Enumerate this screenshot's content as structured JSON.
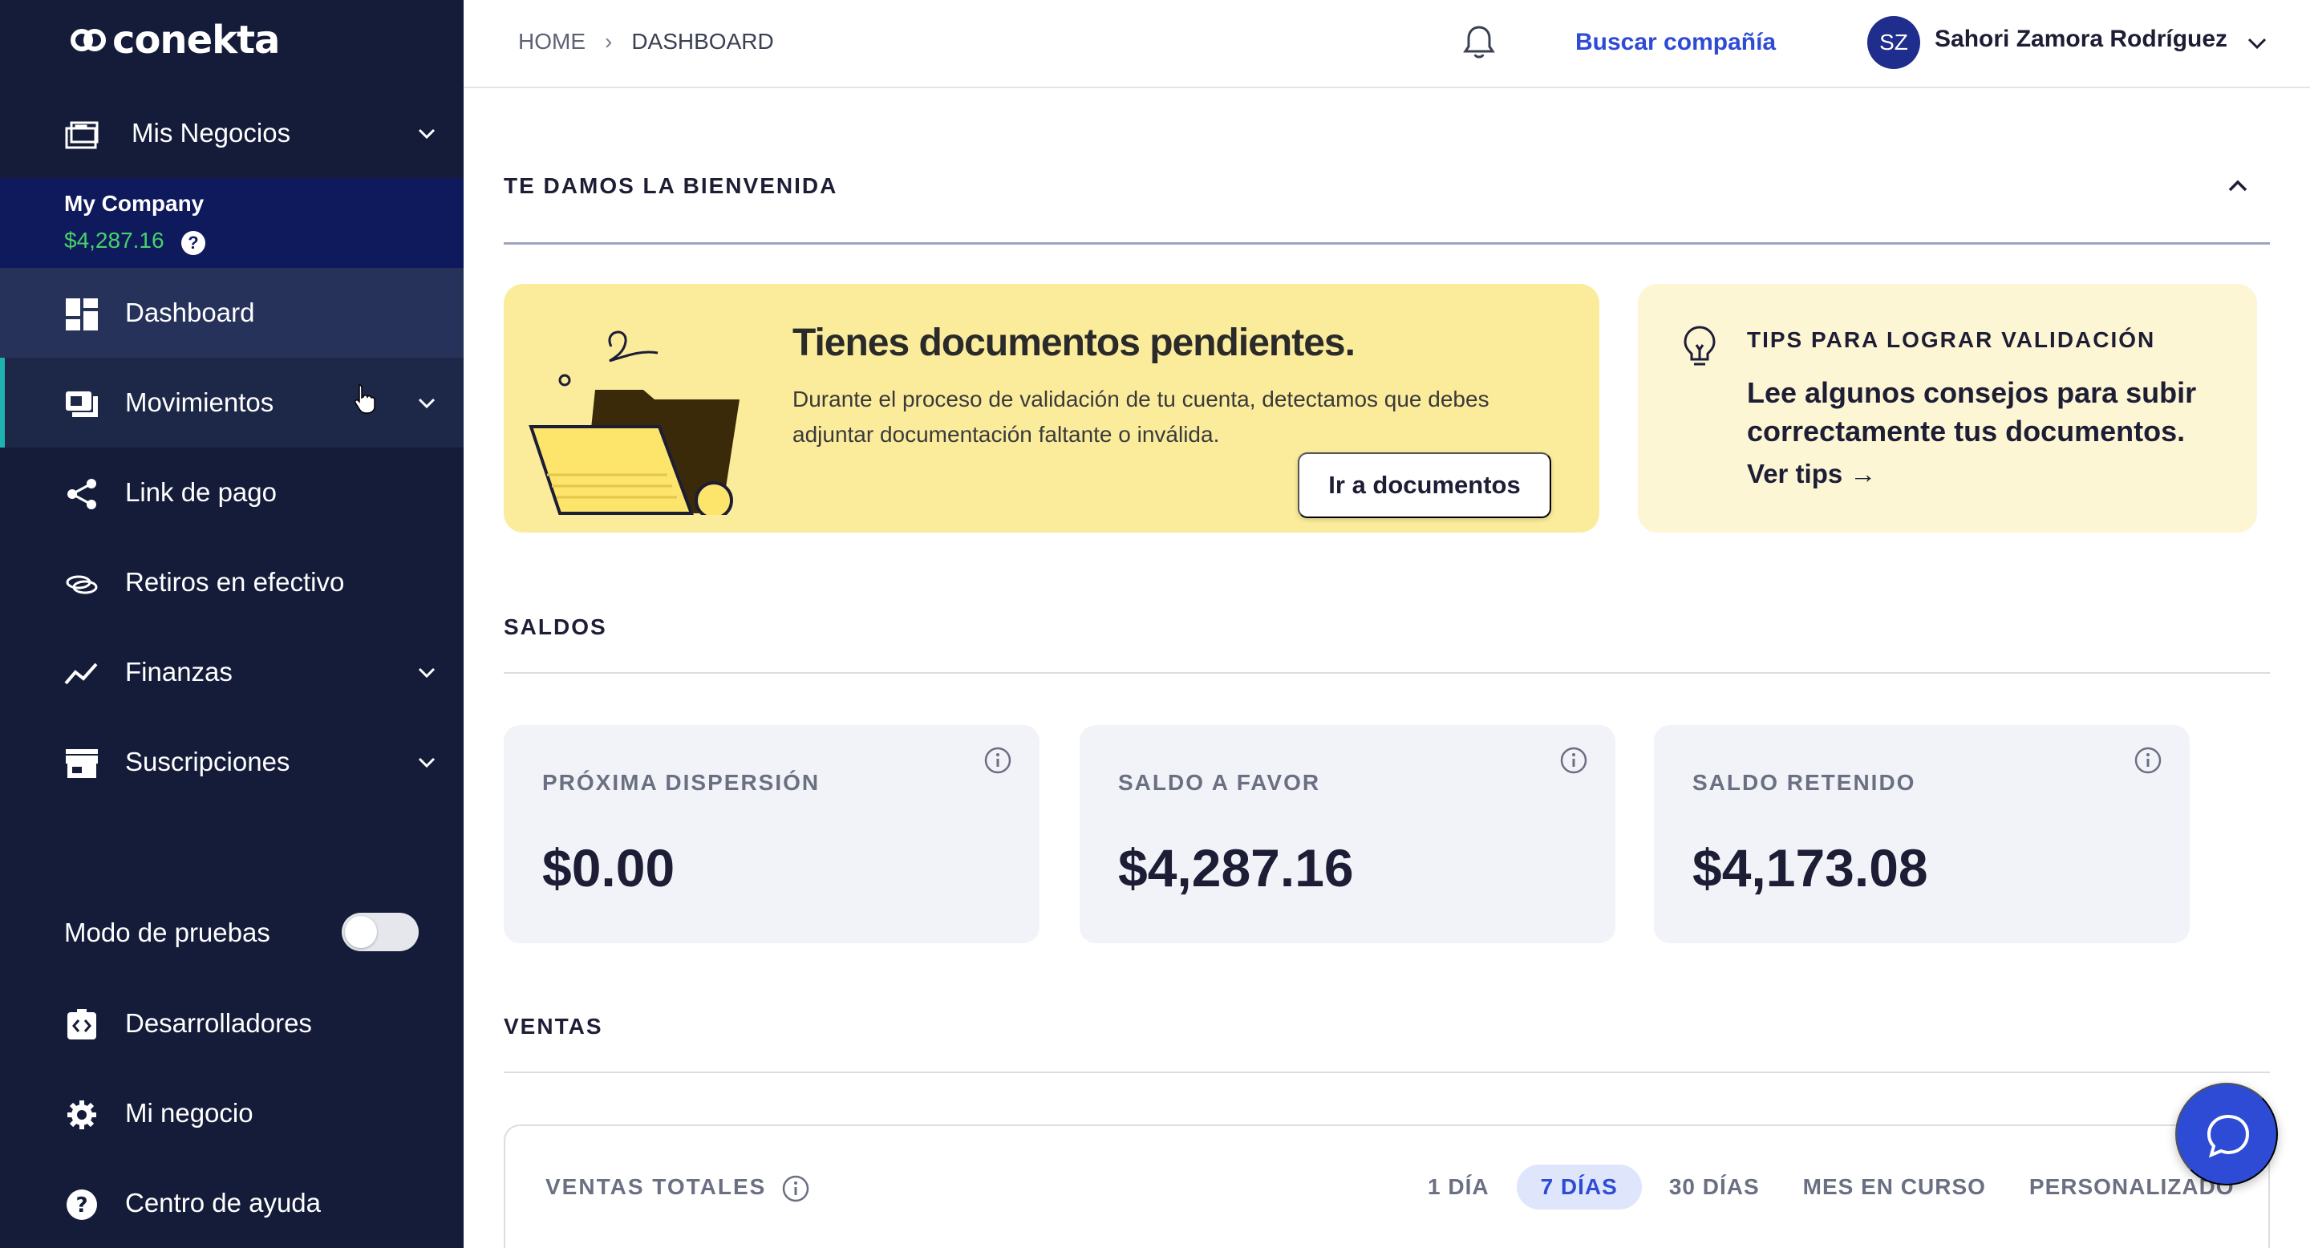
{
  "brand": {
    "name": "conekta"
  },
  "sidebar": {
    "business_menu": "Mis Negocios",
    "company": {
      "name": "My Company",
      "balance": "$4,287.16",
      "help": "?"
    },
    "items": [
      {
        "label": "Dashboard",
        "icon": "dashboard-icon"
      },
      {
        "label": "Movimientos",
        "icon": "movements-icon"
      },
      {
        "label": "Link de pago",
        "icon": "share-icon"
      },
      {
        "label": "Retiros en efectivo",
        "icon": "cash-icon"
      },
      {
        "label": "Finanzas",
        "icon": "chart-line-icon"
      },
      {
        "label": "Suscripciones",
        "icon": "store-icon"
      }
    ],
    "test_mode_label": "Modo de pruebas",
    "footer_items": [
      {
        "label": "Desarrolladores",
        "icon": "code-icon"
      },
      {
        "label": "Mi negocio",
        "icon": "gear-icon"
      },
      {
        "label": "Centro de ayuda",
        "icon": "help-icon"
      }
    ]
  },
  "header": {
    "breadcrumb": [
      "HOME",
      "DASHBOARD"
    ],
    "search_company": "Buscar compañía",
    "user": {
      "initials": "SZ",
      "name": "Sahori Zamora Rodríguez"
    }
  },
  "welcome": {
    "title": "TE DAMOS LA BIENVENIDA",
    "pending": {
      "title": "Tienes documentos pendientes.",
      "text": "Durante el proceso de validación de tu cuenta, detectamos que debes adjuntar documentación faltante o inválida.",
      "button": "Ir a documentos"
    },
    "tips": {
      "title": "TIPS PARA LOGRAR VALIDACIÓN",
      "text": "Lee algunos consejos para subir correctamente tus documentos.",
      "link": "Ver tips →"
    }
  },
  "saldos": {
    "title": "SALDOS",
    "cards": [
      {
        "label": "PRÓXIMA DISPERSIÓN",
        "value": "$0.00"
      },
      {
        "label": "SALDO A FAVOR",
        "value": "$4,287.16"
      },
      {
        "label": "SALDO RETENIDO",
        "value": "$4,173.08"
      }
    ]
  },
  "ventas": {
    "title": "VENTAS",
    "total_label": "VENTAS TOTALES",
    "periods": [
      "1 DÍA",
      "7 DÍAS",
      "30 DÍAS",
      "MES EN CURSO",
      "PERSONALIZADO"
    ],
    "selected_period": "7 DÍAS"
  },
  "colors": {
    "sidebar": "#141c39",
    "accent": "#2e4bd6",
    "positive": "#45d36a",
    "pending_card": "#fbec9c"
  }
}
